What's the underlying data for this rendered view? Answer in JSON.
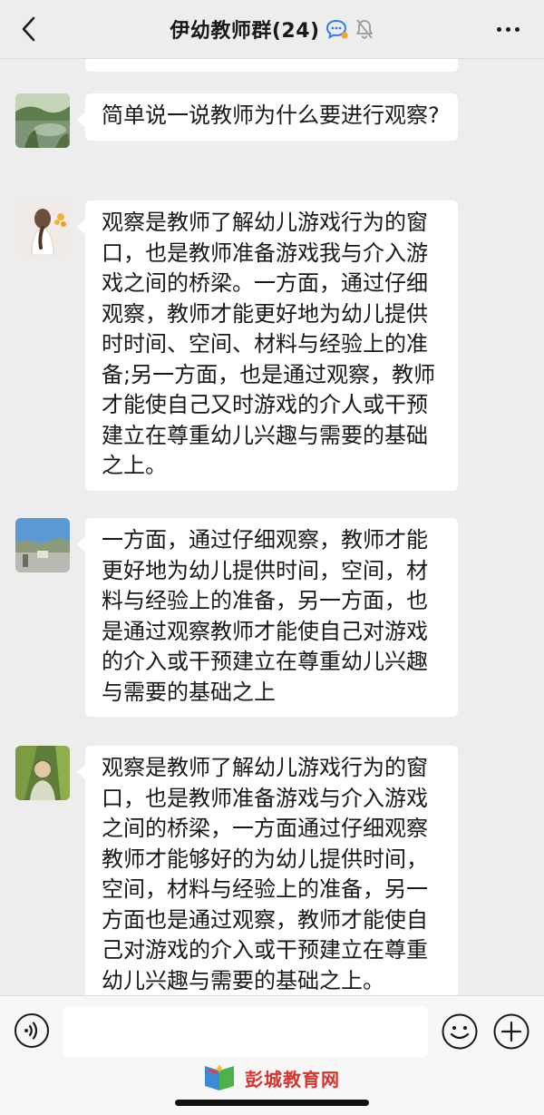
{
  "header": {
    "title": "伊幼教师群(24)",
    "back_icon": "chevron-left-icon",
    "more_icon": "more-dots-icon",
    "status_icons": [
      "chat-bubble-icon",
      "mute-bell-icon"
    ]
  },
  "messages": [
    {
      "avatar": "pond-landscape-avatar",
      "text": "简单说一说教师为什么要进行观察?"
    },
    {
      "avatar": "girl-with-flowers-avatar",
      "text": "观察是教师了解幼儿游戏行为的窗口，也是教师准备游戏我与介入游戏之间的桥梁。一方面，通过仔细观察，教师才能更好地为幼儿提供时时间、空间、材料与经验上的准备;另一方面，也是通过观察，教师才能使自己又时游戏的介人或干预建立在尊重幼儿兴趣与需要的基础之上。"
    },
    {
      "avatar": "sky-landscape-avatar",
      "text": "一方面，通过仔细观察，教师才能更好地为幼儿提供时间，空间，材料与经验上的准备，另一方面，也是通过观察教师才能使自己对游戏的介入或干预建立在尊重幼儿兴趣与需要的基础之上"
    },
    {
      "avatar": "person-with-leaves-avatar",
      "text": "观察是教师了解幼儿游戏行为的窗口，也是教师准备游戏与介入游戏之间的桥梁，一方面通过仔细观察教师才能够好的为幼儿提供时间，空间，材料与经验上的准备，另一方面也是通过观察，教师才能使自己对游戏的介入或干预建立在尊重幼儿兴趣与需要的基础之上。"
    }
  ],
  "input_bar": {
    "voice_icon": "voice-icon",
    "emoji_icon": "emoji-icon",
    "plus_icon": "plus-icon",
    "input_value": ""
  },
  "watermark": {
    "text": "彭城教育网",
    "icon": "book-logo-icon"
  },
  "colors": {
    "background": "#ededed",
    "bubble": "#ffffff",
    "text": "#191919",
    "watermark": "#d8332b",
    "status_blue": "#2f7cf6"
  }
}
